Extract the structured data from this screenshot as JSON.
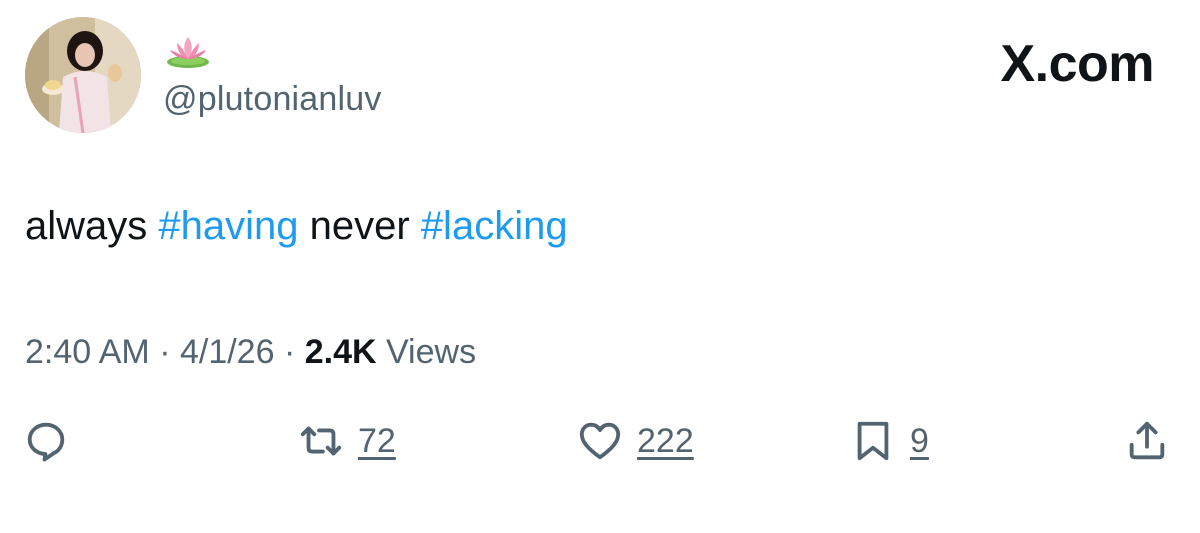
{
  "header": {
    "avatar_icon": "profile-photo",
    "display_name_icon": "lotus-emoji",
    "handle": "@plutonianluv",
    "brand": "X.com"
  },
  "tweet": {
    "text_parts": [
      {
        "text": "always ",
        "type": "plain"
      },
      {
        "text": "#having",
        "type": "hashtag"
      },
      {
        "text": " never ",
        "type": "plain"
      },
      {
        "text": "#lacking",
        "type": "hashtag"
      }
    ]
  },
  "meta": {
    "time": "2:40 AM",
    "sep1": " · ",
    "date": "4/1/26",
    "sep2": " · ",
    "views_count": "2.4K",
    "views_label": " Views"
  },
  "actions": {
    "reply_icon": "reply-icon",
    "repost_icon": "repost-icon",
    "repost_count": "72",
    "like_icon": "heart-icon",
    "like_count": "222",
    "bookmark_icon": "bookmark-icon",
    "bookmark_count": "9",
    "share_icon": "share-icon"
  },
  "colors": {
    "hashtag": "#1d9bf0",
    "secondary_text": "#536471",
    "primary_text": "#0f1419"
  }
}
